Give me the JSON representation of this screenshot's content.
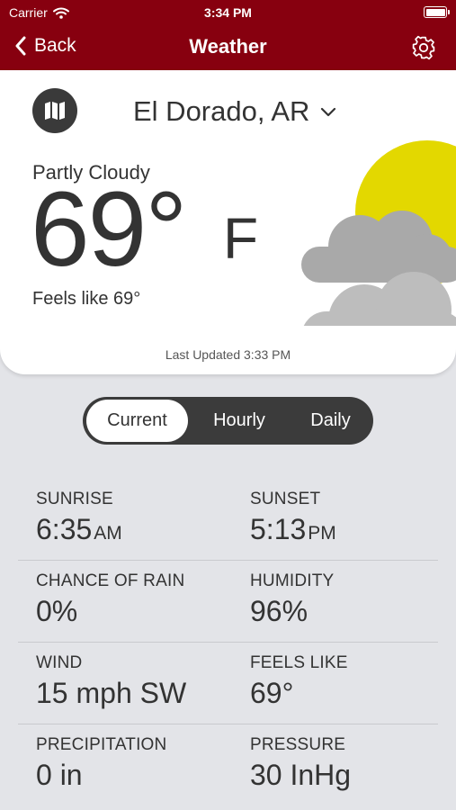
{
  "status_bar": {
    "carrier": "Carrier",
    "time": "3:34 PM"
  },
  "nav": {
    "back_label": "Back",
    "title": "Weather"
  },
  "current": {
    "location": "El Dorado, AR",
    "condition": "Partly Cloudy",
    "temperature": "69°",
    "unit": "F",
    "feels_like": "Feels like 69°",
    "last_updated": "Last Updated 3:33 PM",
    "icon": "partly-cloudy-icon"
  },
  "tabs": [
    {
      "label": "Current",
      "active": true
    },
    {
      "label": "Hourly",
      "active": false
    },
    {
      "label": "Daily",
      "active": false
    }
  ],
  "details": {
    "sunrise": {
      "label": "SUNRISE",
      "value": "6:35",
      "suffix": "AM"
    },
    "sunset": {
      "label": "SUNSET",
      "value": "5:13",
      "suffix": "PM"
    },
    "chance_of_rain": {
      "label": "CHANCE OF RAIN",
      "value": "0%"
    },
    "humidity": {
      "label": "HUMIDITY",
      "value": "96%"
    },
    "wind": {
      "label": "WIND",
      "value": "15 mph SW"
    },
    "feels_like": {
      "label": "FEELS LIKE",
      "value": "69°"
    },
    "precipitation": {
      "label": "PRECIPITATION",
      "value": "0 in"
    },
    "pressure": {
      "label": "PRESSURE",
      "value": "30 InHg"
    }
  },
  "colors": {
    "brand": "#87000f",
    "sun": "#e3d800",
    "cloud": "#a9a9a9",
    "background": "#e3e4e8"
  }
}
